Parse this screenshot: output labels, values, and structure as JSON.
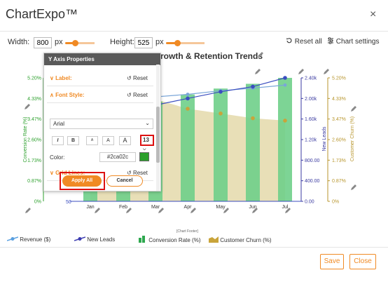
{
  "app": {
    "title": "ChartExpo™",
    "close_glyph": "×"
  },
  "toolbar": {
    "width_label": "Width:",
    "width_value": "800",
    "width_unit": "px",
    "width_level": 0.35,
    "height_label": "Height:",
    "height_value": "525",
    "height_unit": "px",
    "height_level": 0.3,
    "reset_label": "Reset all",
    "settings_label": "Chart settings"
  },
  "chart_data": {
    "type": "bar",
    "title": "rowth & Retention Trends",
    "categories": [
      "Jan",
      "Feb",
      "Mar",
      "Apr",
      "May",
      "Jun",
      "Jul"
    ],
    "series": [
      {
        "name": "Conversion Rate (%)",
        "type": "bar",
        "axis": "left",
        "values": [
          3.5,
          3.9,
          4.2,
          4.5,
          4.75,
          4.95,
          5.2
        ]
      },
      {
        "name": "Customer Churn (%)",
        "type": "area",
        "axis": "right",
        "values": [
          4.8,
          4.6,
          4.3,
          3.9,
          3.7,
          3.5,
          3.4
        ]
      },
      {
        "name": "Revenue ($)",
        "type": "line",
        "axis": "right-inner",
        "values": [
          2020,
          1960,
          2030,
          2080,
          2150,
          2200,
          2260
        ]
      },
      {
        "name": "New Leads",
        "type": "line",
        "axis": "right-inner",
        "values": [
          1580,
          1730,
          1870,
          2000,
          2130,
          2230,
          2400
        ]
      }
    ],
    "left_axis": {
      "label": "Conversion Rate (%)",
      "ticks": [
        "5.20%",
        "4.33%",
        "3.47%",
        "2.60%",
        "1.73%",
        "0.87%",
        "0%"
      ],
      "ylim": [
        0,
        5.2
      ],
      "color": "#2ca02c"
    },
    "right_inner_axis": {
      "label": "New Leads",
      "ticks": [
        "2.40k",
        "2.00k",
        "1.60k",
        "1.20k",
        "800.00",
        "400.00",
        "0.00"
      ],
      "ylim": [
        0,
        2400
      ],
      "color": "#3a3aa0"
    },
    "right_axis": {
      "label": "Customer Churn (%)",
      "ticks": [
        "5.20%",
        "4.33%",
        "3.47%",
        "2.60%",
        "1.73%",
        "0.87%",
        "0%"
      ],
      "ylim": [
        0,
        5.2
      ],
      "color": "#b8962e"
    },
    "footer_note": "[Chart Footer]",
    "partial_tick": "50",
    "colors": {
      "bar": "#6fcf8a",
      "area": "#e8dfb7",
      "revenue": "#7aa6d8",
      "leads": "#3b4ec0",
      "churn_dot": "#c9a43a"
    }
  },
  "panel": {
    "title": "Y Axis Properties",
    "label_section": "Label:",
    "font_section": "Font Style:",
    "grid_section": "Grid Lines:",
    "reset_label": "Reset",
    "font_name": "Arial",
    "font_buttons": [
      "I",
      "B",
      "A",
      "A",
      "A"
    ],
    "font_size": "13",
    "color_label": "Color:",
    "color_value": "#2ca02c",
    "apply_label": "Apply All",
    "cancel_label": "Cancel"
  },
  "legend": [
    {
      "label": "Revenue ($)",
      "icon": "line-dot-icon",
      "color": "#5aa0e0"
    },
    {
      "label": "New Leads",
      "icon": "line-dot-icon",
      "color": "#3b3bb0"
    },
    {
      "label": "Conversion Rate (%)",
      "icon": "bar-swatch-icon",
      "color": "#2fa84f"
    },
    {
      "label": "Customer Churn (%)",
      "icon": "area-swatch-icon",
      "color": "#c9a43a"
    }
  ],
  "footer": {
    "save_label": "Save",
    "close_label": "Close"
  }
}
